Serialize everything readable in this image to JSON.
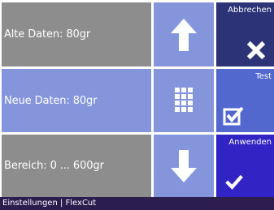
{
  "fields": {
    "old_data": "Alte Daten: 80gr",
    "new_data": "Neue Daten: 80gr",
    "range": "Bereich: 0 ... 600gr"
  },
  "buttons": {
    "cancel_label": "Abbrechen",
    "test_label": "Test",
    "apply_label": "Anwenden"
  },
  "icons": {
    "up": "arrow-up-icon",
    "keypad": "keypad-icon",
    "down": "arrow-down-icon",
    "cancel": "close-icon",
    "test": "checkbox-checked-icon",
    "apply": "checkmark-icon"
  },
  "colors": {
    "field_grey": "#8d8d8d",
    "field_blue": "#8595dc",
    "cancel": "#2c3477",
    "test": "#5368cf",
    "apply": "#3224c4",
    "statusbar": "#2b1d4e"
  },
  "statusbar": {
    "text": "Einstellungen | FlexCut"
  }
}
